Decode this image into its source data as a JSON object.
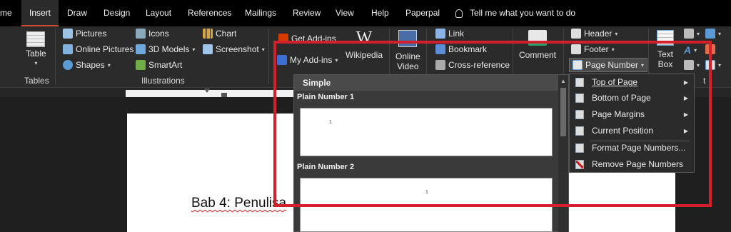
{
  "tabs": [
    "me",
    "Insert",
    "Draw",
    "Design",
    "Layout",
    "References",
    "Mailings",
    "Review",
    "View",
    "Help",
    "Paperpal"
  ],
  "tellme": "Tell me what you want to do",
  "ribbon": {
    "table": "Table",
    "tables_group": "Tables",
    "pictures": "Pictures",
    "online_pictures": "Online Pictures",
    "shapes": "Shapes",
    "icons": "Icons",
    "models": "3D Models",
    "smartart": "SmartArt",
    "chart": "Chart",
    "screenshot": "Screenshot",
    "illustrations_group": "Illustrations",
    "get_addins": "Get Add-ins",
    "my_addins": "My Add-ins",
    "wikipedia": "Wikipedia",
    "online_video_1": "Online",
    "online_video_2": "Video",
    "link": "Link",
    "bookmark": "Bookmark",
    "crossref": "Cross-reference",
    "comment": "Comment",
    "header": "Header",
    "footer": "Footer",
    "page_number": "Page Number",
    "textbox_1": "Text",
    "textbox_2": "Box",
    "group_t": "t"
  },
  "document": {
    "text": "Bab 4: Penulisa"
  },
  "gallery": {
    "heading": "Simple",
    "items": [
      "Plain Number 1",
      "Plain Number 2"
    ],
    "marker": "1"
  },
  "menu": {
    "items": [
      "Top of Page",
      "Bottom of Page",
      "Page Margins",
      "Current Position",
      "Format Page Numbers...",
      "Remove Page Numbers"
    ]
  },
  "colors": {
    "accent": "#d04a30",
    "highlight": "#d3202a",
    "background": "#262626"
  }
}
